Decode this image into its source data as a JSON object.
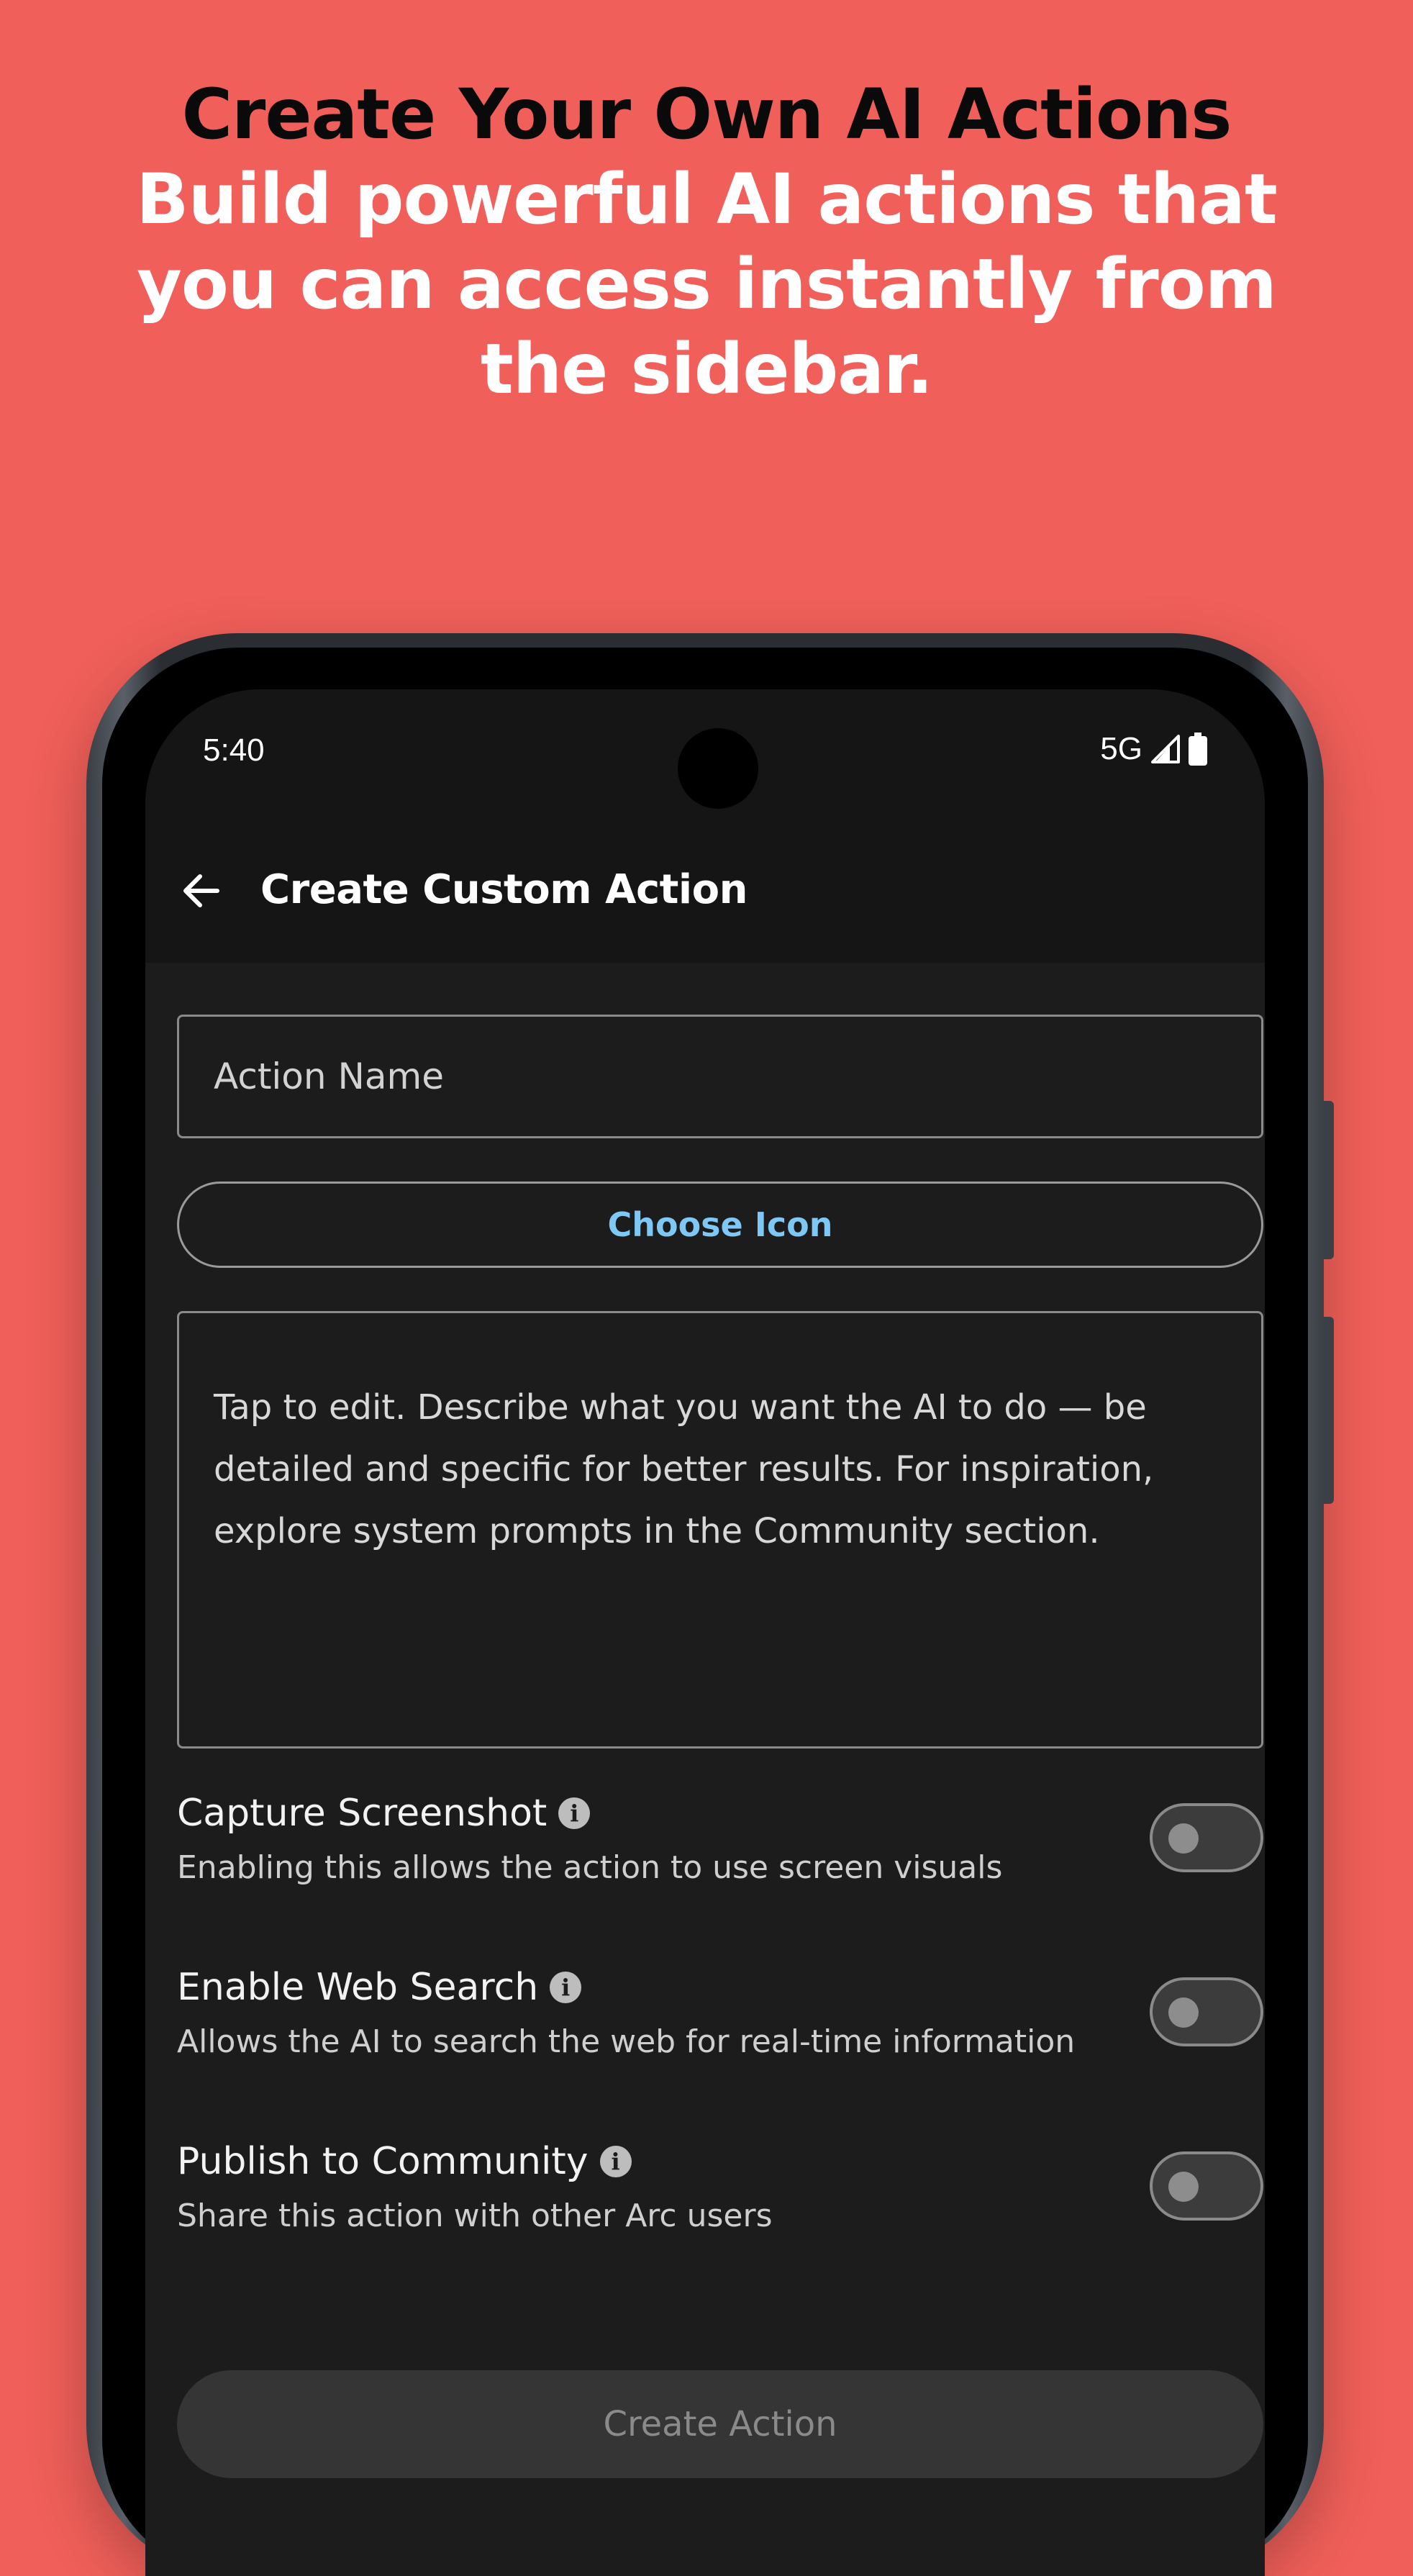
{
  "promo": {
    "title": "Create Your Own AI Actions",
    "subtitle": "Build powerful AI actions that you can access instantly from the sidebar."
  },
  "status_bar": {
    "time": "5:40",
    "network": "5G",
    "icons": [
      "signal-icon",
      "battery-icon"
    ]
  },
  "app_bar": {
    "back_icon": "arrow-back-icon",
    "title": "Create Custom Action"
  },
  "form": {
    "action_name_placeholder": "Action Name",
    "choose_icon_label": "Choose Icon",
    "prompt_placeholder": "Tap to edit. Describe what you want the AI to do — be detailed and specific for better results. For inspiration, explore system prompts in the Community section."
  },
  "toggles": [
    {
      "title": "Capture Screenshot",
      "description": "Enabling this allows the action to use screen visuals",
      "enabled": false
    },
    {
      "title": "Enable Web Search",
      "description": "Allows the AI to search the web for real-time information",
      "enabled": false
    },
    {
      "title": "Publish to Community",
      "description": "Share this action with other Arc users",
      "enabled": false
    }
  ],
  "create_button_label": "Create Action",
  "colors": {
    "background": "#F05F59",
    "screen": "#1C1C1C",
    "accent_link": "#7EC8F6"
  }
}
